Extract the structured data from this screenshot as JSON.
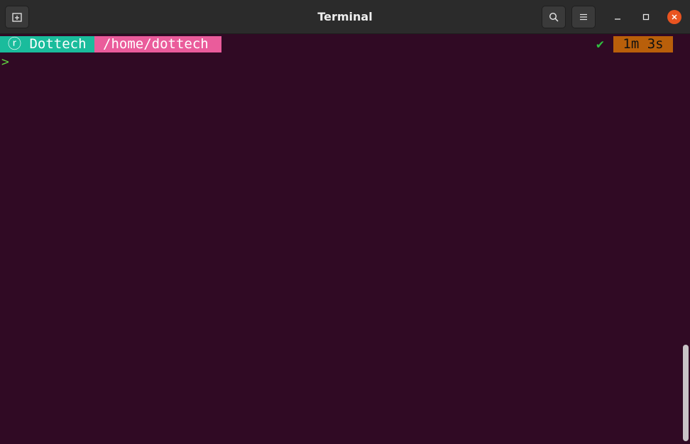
{
  "window": {
    "title": "Terminal"
  },
  "prompt_line": {
    "user_icon": "ⓡ",
    "user": "Dottech",
    "path": "/home/dottech",
    "status_icon": "✔",
    "duration": "1m 3s",
    "prompt_symbol": ">"
  },
  "colors": {
    "terminal_bg": "#300a24",
    "user_segment": "#1abc9c",
    "path_segment": "#ea5c9b",
    "duration_segment": "#b95f0a",
    "close_button": "#e95420",
    "success": "#30c040",
    "prompt": "#5fcf3f"
  },
  "icons": {
    "new_tab": "new-tab-icon",
    "search": "search-icon",
    "menu": "hamburger-menu-icon",
    "minimize": "minimize-icon",
    "maximize": "maximize-icon",
    "close": "close-icon"
  }
}
